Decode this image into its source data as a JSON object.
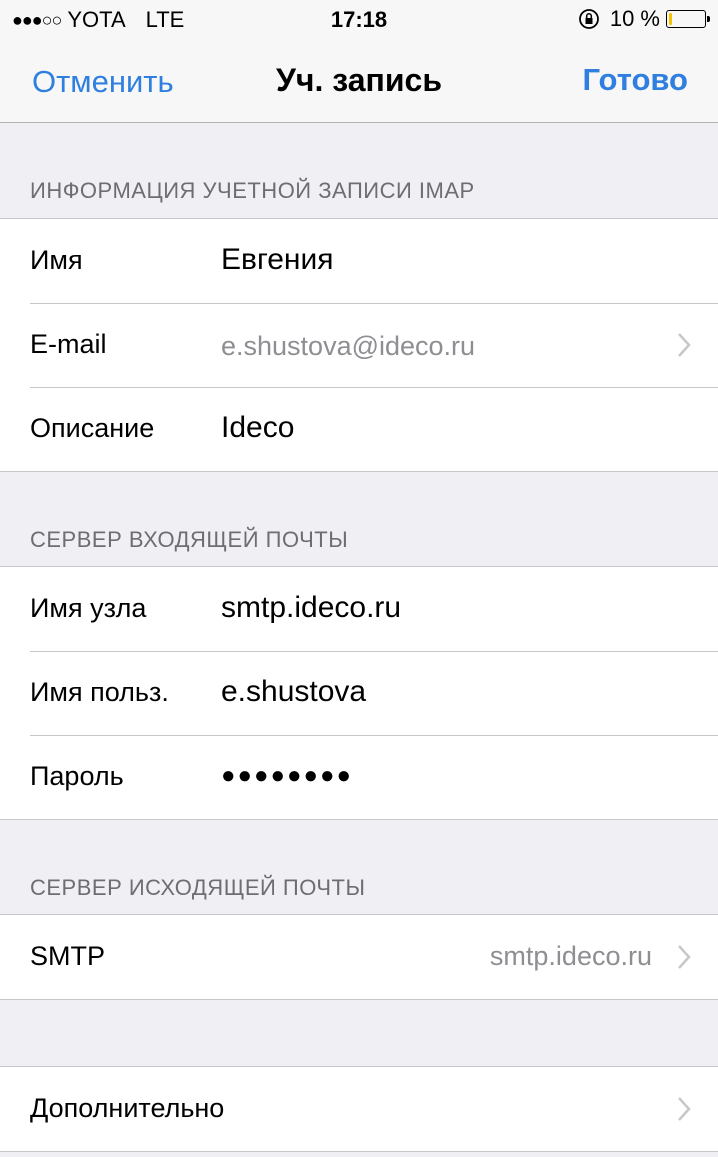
{
  "status_bar": {
    "signal": "●●●○○",
    "carrier": "YOTA",
    "network": "LTE",
    "time": "17:18",
    "battery_percent": "10 %",
    "battery_level": 0.1,
    "icons": [
      "rotation-lock-icon",
      "battery-icon"
    ]
  },
  "nav": {
    "cancel": "Отменить",
    "title": "Уч. запись",
    "done": "Готово",
    "accent_color": "#2f7fe0"
  },
  "sections": {
    "account": {
      "header": "ИНФОРМАЦИЯ УЧЕТНОЙ ЗАПИСИ IMAP",
      "name_label": "Имя",
      "name_value": "Евгения",
      "email_label": "E-mail",
      "email_value": "e.shustova@ideco.ru",
      "description_label": "Описание",
      "description_value": "Ideco"
    },
    "incoming": {
      "header": "СЕРВЕР ВХОДЯЩЕЙ ПОЧТЫ",
      "host_label": "Имя узла",
      "host_value": "smtp.ideco.ru",
      "user_label": "Имя польз.",
      "user_value": "e.shustova",
      "password_label": "Пароль",
      "password_value": "●●●●●●●●"
    },
    "outgoing": {
      "header": "СЕРВЕР ИСХОДЯЩЕЙ ПОЧТЫ",
      "smtp_label": "SMTP",
      "smtp_value": "smtp.ideco.ru"
    },
    "advanced": {
      "label": "Дополнительно"
    }
  }
}
